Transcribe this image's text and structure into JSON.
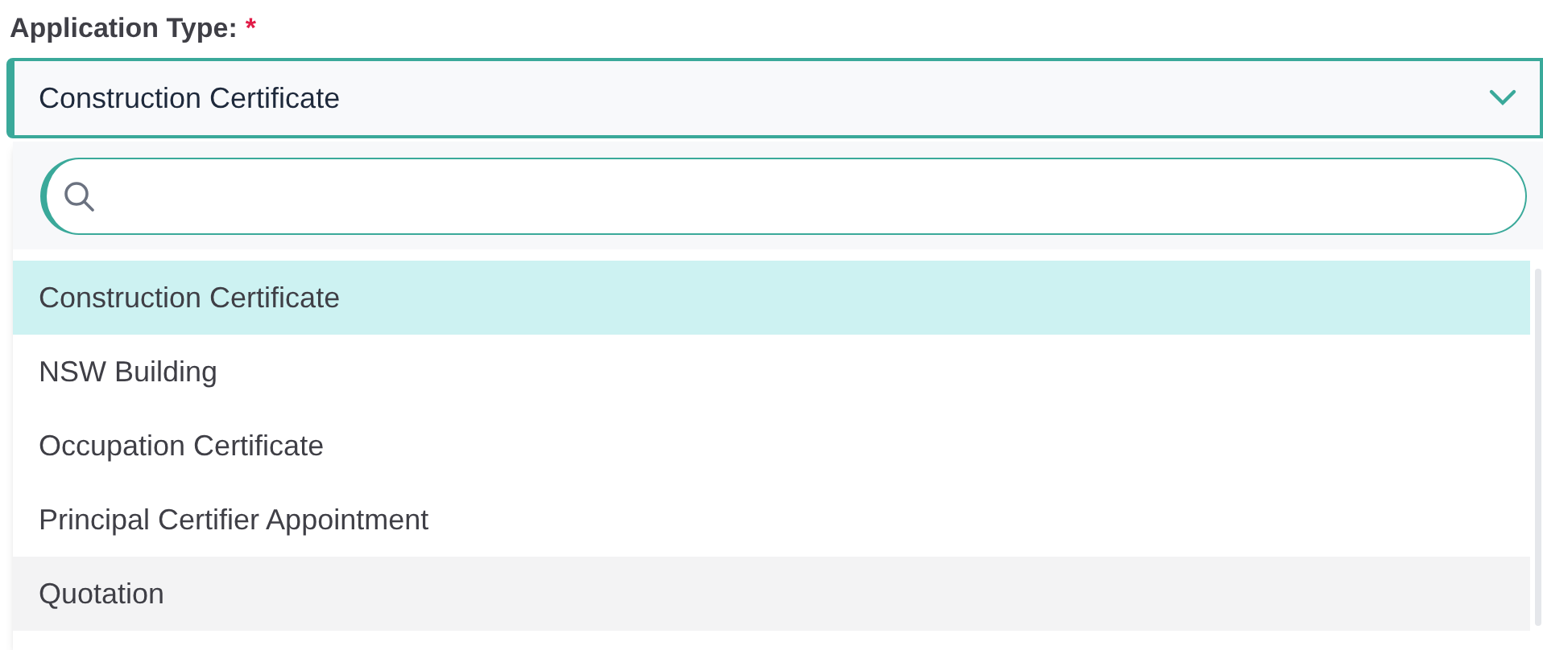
{
  "field": {
    "label": "Application Type:",
    "required_mark": "*",
    "value": "Construction Certificate",
    "expanded": true
  },
  "dropdown": {
    "options": [
      {
        "label": "Construction Certificate",
        "selected": true,
        "hovered": false
      },
      {
        "label": "NSW Building",
        "selected": false,
        "hovered": false
      },
      {
        "label": "Occupation Certificate",
        "selected": false,
        "hovered": false
      },
      {
        "label": "Principal Certifier Appointment",
        "selected": false,
        "hovered": false
      },
      {
        "label": "Quotation",
        "selected": false,
        "hovered": true
      }
    ]
  }
}
